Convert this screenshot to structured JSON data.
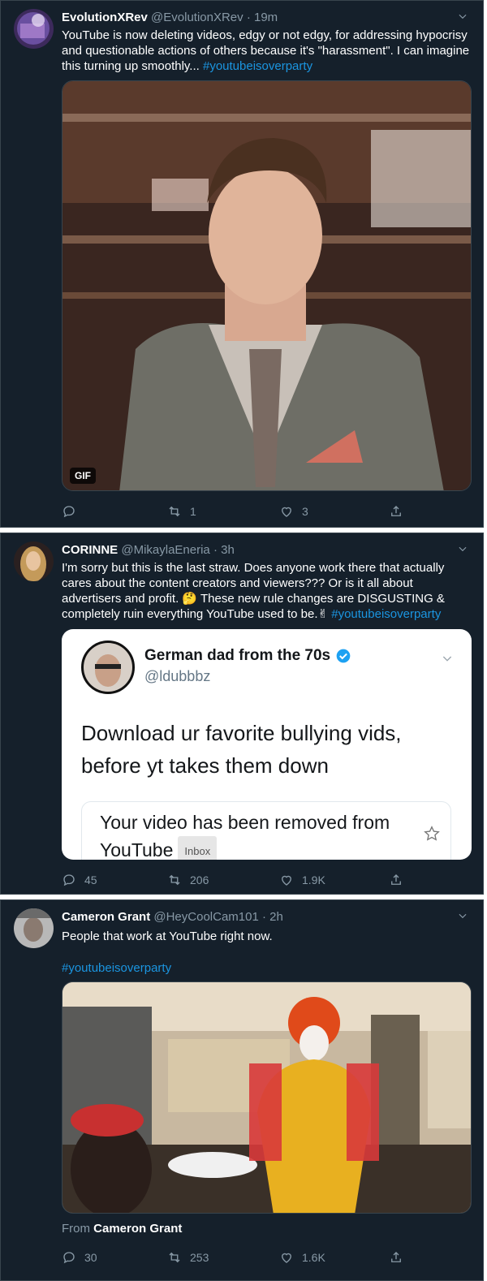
{
  "tweets": [
    {
      "name": "EvolutionXRev",
      "handle": "@EvolutionXRev",
      "time": "19m",
      "text": "YouTube is now deleting videos, edgy or not edgy, for addressing hypocrisy and questionable actions of others because it's \"harassment\". I can imagine this turning up smoothly... ",
      "hashtag": "#youtubeisoverparty",
      "media_badge": "GIF",
      "retweets": "1",
      "likes": "3"
    },
    {
      "name": "CORINNE",
      "handle": "@MikaylaEneria",
      "time": "3h",
      "text": "I'm sorry but this is the last straw. Does anyone work there that actually cares about the content creators and viewers??? Or is it all about advertisers and profit. 🤔 These new rule changes are DISGUSTING & completely ruin everything YouTube used to be.✌ ",
      "hashtag": "#youtubeisoverparty",
      "card": {
        "name": "German dad from the 70s",
        "handle": "@ldubbbz",
        "text": "Download ur favorite bullying vids, before yt takes them down",
        "inner_text": "Your video has been removed from YouTube",
        "inner_badge": "Inbox"
      },
      "replies": "45",
      "retweets": "206",
      "likes": "1.9K"
    },
    {
      "name": "Cameron Grant",
      "handle": "@HeyCoolCam101",
      "time": "2h",
      "text": "People that work at YouTube right now.",
      "hashtag": "#youtubeisoverparty",
      "from_label": "From",
      "from_name": "Cameron Grant",
      "replies": "30",
      "retweets": "253",
      "likes": "1.6K"
    }
  ],
  "separator": "·",
  "colors": {
    "background": "#15202b",
    "border": "#38444d",
    "muted": "#8899a6",
    "link": "#1b95e0",
    "verified": "#1da1f2"
  },
  "icons": [
    "reply-icon",
    "retweet-icon",
    "like-icon",
    "share-icon",
    "chevron-down-icon",
    "verified-icon",
    "star-icon"
  ]
}
